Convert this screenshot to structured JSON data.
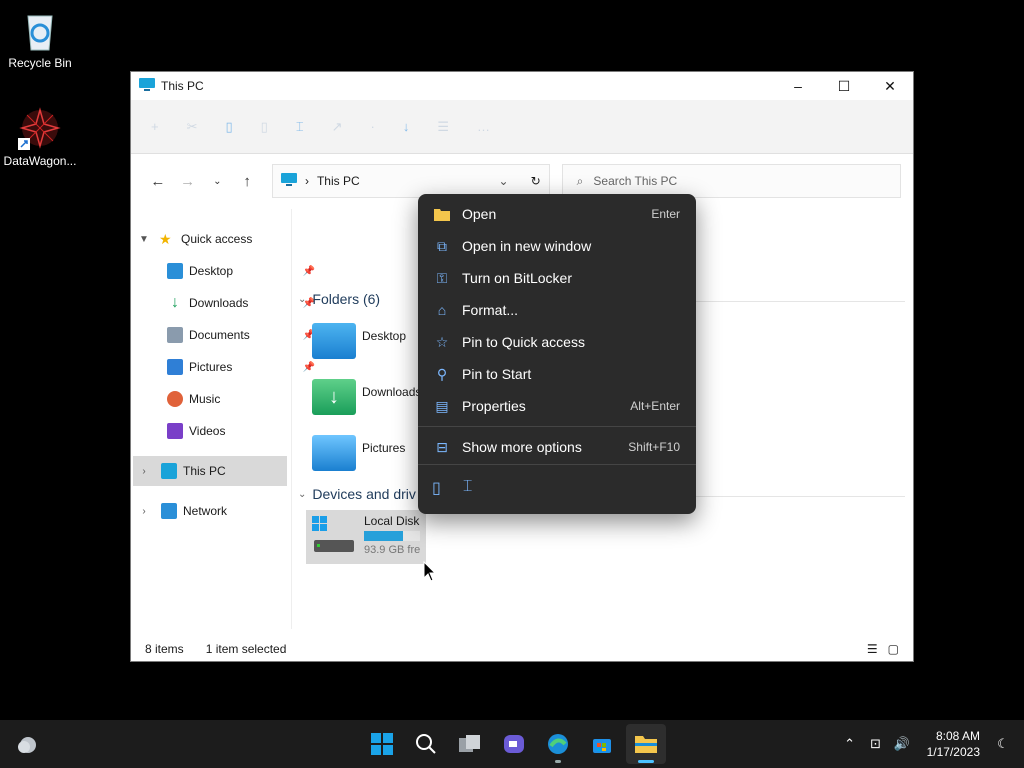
{
  "desktop": {
    "icons": [
      {
        "label": "Recycle Bin"
      },
      {
        "label": "DataWagon..."
      }
    ]
  },
  "window": {
    "title": "This PC",
    "controls": {
      "minimize": "–",
      "maximize": "☐",
      "close": "✕"
    }
  },
  "address": {
    "location": "This PC",
    "search_placeholder": "Search This PC"
  },
  "nav": {
    "quick_access": "Quick access",
    "items": [
      {
        "label": "Desktop"
      },
      {
        "label": "Downloads"
      },
      {
        "label": "Documents"
      },
      {
        "label": "Pictures"
      },
      {
        "label": "Music"
      },
      {
        "label": "Videos"
      }
    ],
    "this_pc": "This PC",
    "network": "Network"
  },
  "content": {
    "folders_header": "Folders (6)",
    "folders": [
      {
        "name": "Desktop"
      },
      {
        "name": "Downloads"
      },
      {
        "name": "Pictures"
      }
    ],
    "devices_header": "Devices and driv",
    "disk": {
      "name": "Local Disk",
      "free": "93.9 GB fre",
      "used_fraction": 0.7
    }
  },
  "context_menu": {
    "items": [
      {
        "label": "Open",
        "shortcut": "Enter",
        "icon": "folder-icon"
      },
      {
        "label": "Open in new window",
        "shortcut": "",
        "icon": "new-window-icon"
      },
      {
        "label": "Turn on BitLocker",
        "shortcut": "",
        "icon": "key-icon"
      },
      {
        "label": "Format...",
        "shortcut": "",
        "icon": "format-icon"
      },
      {
        "label": "Pin to Quick access",
        "shortcut": "",
        "icon": "star-icon"
      },
      {
        "label": "Pin to Start",
        "shortcut": "",
        "icon": "pin-icon"
      },
      {
        "label": "Properties",
        "shortcut": "Alt+Enter",
        "icon": "properties-icon"
      },
      {
        "label": "Show more options",
        "shortcut": "Shift+F10",
        "icon": "more-options-icon"
      }
    ]
  },
  "status": {
    "items_count": "8 items",
    "selected": "1 item selected"
  },
  "taskbar": {
    "time": "8:08 AM",
    "date": "1/17/2023"
  },
  "colors": {
    "accent": "#4cc2ff",
    "menu_bg": "#2b2b2b",
    "taskbar_bg": "#1c1c1c"
  }
}
